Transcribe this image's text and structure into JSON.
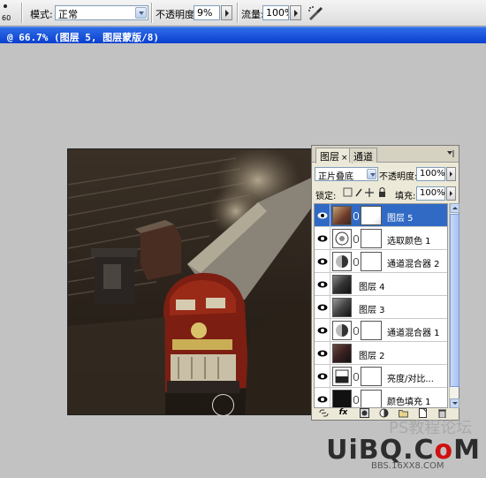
{
  "options_bar": {
    "brush_size": "60",
    "mode_label": "模式:",
    "mode_value": "正常",
    "opacity_label": "不透明度:",
    "opacity_value": "9%",
    "flow_label": "流量:",
    "flow_value": "100%"
  },
  "document": {
    "title": "@ 66.7% (图层 5, 图层蒙版/8)"
  },
  "layers_panel": {
    "tabs": [
      {
        "label": "图层",
        "close": "×"
      },
      {
        "label": "通道"
      }
    ],
    "blend_mode": "正片叠底",
    "opacity_label": "不透明度:",
    "opacity_value": "100%",
    "lock_label": "锁定:",
    "fill_label": "填充:",
    "fill_value": "100%",
    "layers": [
      {
        "name": "图层 5",
        "selected": true,
        "has_mask": true
      },
      {
        "name": "选取颜色 1",
        "selected": false,
        "has_mask": true
      },
      {
        "name": "通道混合器 2",
        "selected": false,
        "has_mask": true
      },
      {
        "name": "图层 4",
        "selected": false,
        "has_mask": false
      },
      {
        "name": "图层 3",
        "selected": false,
        "has_mask": false
      },
      {
        "name": "通道混合器 1",
        "selected": false,
        "has_mask": true
      },
      {
        "name": "图层 2",
        "selected": false,
        "has_mask": false
      },
      {
        "name": "亮度/对比...",
        "selected": false,
        "has_mask": true
      },
      {
        "name": "颜色填充 1",
        "selected": false,
        "has_mask": true
      }
    ],
    "footer_icons": [
      "link-icon",
      "fx-icon",
      "mask-icon",
      "adjustment-icon",
      "folder-icon",
      "new-layer-icon",
      "trash-icon"
    ]
  },
  "watermark": {
    "main_1": "UiBQ.C",
    "main_2": "o",
    "main_3": "M",
    "sub": "BBS.16XX8.COM",
    "faint": "PS教程论坛"
  }
}
